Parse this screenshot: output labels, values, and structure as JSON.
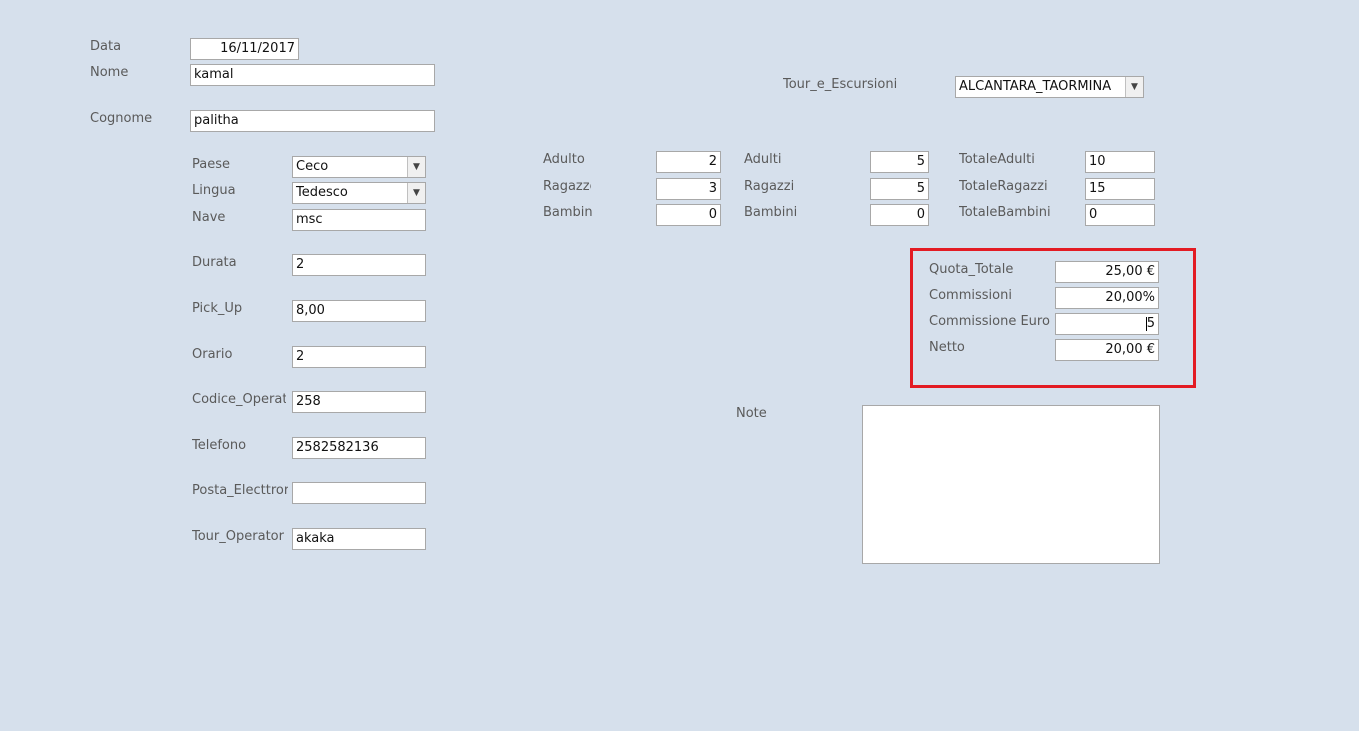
{
  "fields": {
    "data": {
      "label": "Data",
      "value": "16/11/2017"
    },
    "nome": {
      "label": "Nome",
      "value": "kamal"
    },
    "cognome": {
      "label": "Cognome",
      "value": "palitha"
    },
    "paese": {
      "label": "Paese",
      "value": "Ceco"
    },
    "lingua": {
      "label": "Lingua",
      "value": "Tedesco"
    },
    "nave": {
      "label": "Nave",
      "value": "msc"
    },
    "durata": {
      "label": "Durata",
      "value": "2"
    },
    "pick_up": {
      "label": "Pick_Up",
      "value": "8,00"
    },
    "orario": {
      "label": "Orario",
      "value": "2"
    },
    "codice_operatore": {
      "label": "Codice_Operat",
      "value": "258"
    },
    "telefono": {
      "label": "Telefono",
      "value": "2582582136"
    },
    "posta_elettronica": {
      "label": "Posta_Electtror",
      "value": ""
    },
    "tour_operator": {
      "label": "Tour_Operator",
      "value": "akaka"
    },
    "tour_e_escursioni": {
      "label": "Tour_e_Escursioni",
      "value": "ALCANTARA_TAORMINA"
    },
    "adulto": {
      "label": "Adulto",
      "value": "2"
    },
    "ragazzo": {
      "label": "Ragazzc",
      "value": "3"
    },
    "bambino": {
      "label": "Bambin",
      "value": "0"
    },
    "adulti": {
      "label": "Adulti",
      "value": "5"
    },
    "ragazzi": {
      "label": "Ragazzi",
      "value": "5"
    },
    "bambini": {
      "label": "Bambini",
      "value": "0"
    },
    "totale_adulti": {
      "label": "TotaleAdulti",
      "value": "10"
    },
    "totale_ragazzi": {
      "label": "TotaleRagazzi",
      "value": "15"
    },
    "totale_bambini": {
      "label": "TotaleBambini",
      "value": "0"
    },
    "quota_totale": {
      "label": "Quota_Totale",
      "value": "25,00 €"
    },
    "commissioni": {
      "label": "Commissioni",
      "value": "20,00%"
    },
    "commissione_euro": {
      "label": "Commissione Euro",
      "value": "5"
    },
    "netto": {
      "label": "Netto",
      "value": "20,00 €"
    },
    "note": {
      "label": "Note",
      "value": ""
    }
  },
  "icons": {
    "dropdown": "chevron-down-icon"
  },
  "colors": {
    "background": "#d6e0ec",
    "highlight_frame": "#e31b23"
  }
}
